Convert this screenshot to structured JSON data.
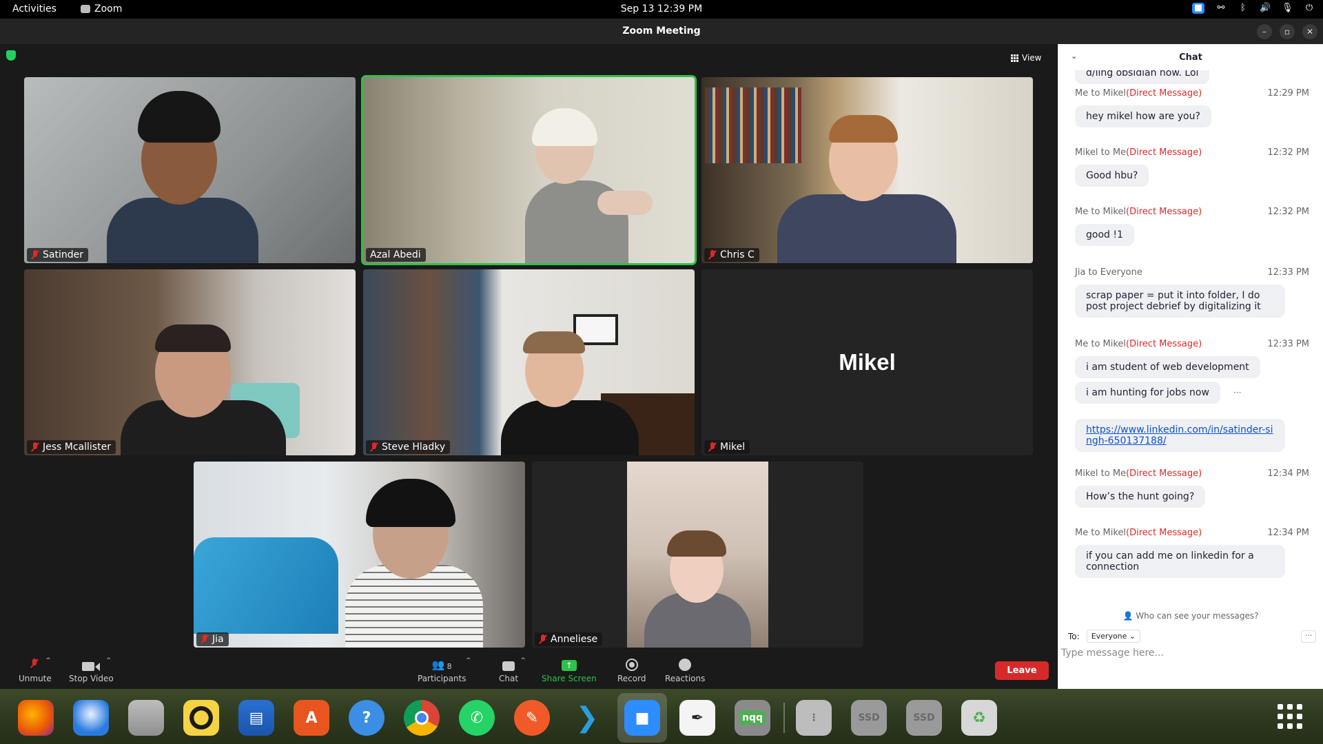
{
  "topbar": {
    "activities": "Activities",
    "app_name": "Zoom",
    "clock": "Sep 13  12:39 PM"
  },
  "window": {
    "title": "Zoom Meeting"
  },
  "meeting": {
    "view_label": "View",
    "participants": [
      {
        "name": "Satinder",
        "muted": true
      },
      {
        "name": "Azal Abedi",
        "muted": false,
        "active_speaker": true
      },
      {
        "name": "Chris C",
        "muted": true
      },
      {
        "name": "Jess Mcallister",
        "muted": true
      },
      {
        "name": "Steve Hladky",
        "muted": true
      },
      {
        "name": "Mikel",
        "muted": true,
        "video_off": true,
        "display_text": "Mikel"
      },
      {
        "name": "Jia",
        "muted": true
      },
      {
        "name": "Anneliese",
        "muted": true
      }
    ]
  },
  "chat": {
    "title": "Chat",
    "messages": [
      {
        "sender": "",
        "dm": "",
        "time": "",
        "text": "d/ling obsidian now. Lol"
      },
      {
        "sender": "Me to Mikel",
        "dm": "(Direct Message)",
        "time": "12:29 PM",
        "text": "hey mikel how are you?"
      },
      {
        "sender": "Mikel to Me",
        "dm": "(Direct Message)",
        "time": "12:32 PM",
        "text": "Good hbu?"
      },
      {
        "sender": "Me to Mikel",
        "dm": "(Direct Message)",
        "time": "12:32 PM",
        "text": "good !1"
      },
      {
        "sender": "Jia to Everyone",
        "dm": "",
        "time": "12:33 PM",
        "text": "scrap paper = put it into folder, I do post project debrief by digitalizing it"
      },
      {
        "sender": "Me to Mikel",
        "dm": "(Direct Message)",
        "time": "12:33 PM",
        "text": "i am student of web development"
      },
      {
        "sender": "",
        "dm": "",
        "time": "",
        "text": "i am hunting for jobs now"
      },
      {
        "sender": "",
        "dm": "",
        "time": "",
        "text": "https://www.linkedin.com/in/satinder-singh-650137188/"
      },
      {
        "sender": "Mikel to Me",
        "dm": "(Direct Message)",
        "time": "12:34 PM",
        "text": "How’s the hunt going?"
      },
      {
        "sender": "Me to Mikel",
        "dm": "(Direct Message)",
        "time": "12:34 PM",
        "text": "if you can add me on linkedin for a connection"
      }
    ],
    "more_glyph": "···",
    "who_can_see": "Who can see your messages?",
    "to_label": "To:",
    "to_value": "Everyone",
    "to_more": "···",
    "input_placeholder": "Type message here..."
  },
  "toolbar": {
    "unmute": "Unmute",
    "stop_video": "Stop Video",
    "participants": "Participants",
    "participants_count": "8",
    "chat": "Chat",
    "share_screen": "Share Screen",
    "record": "Record",
    "reactions": "Reactions",
    "leave": "Leave"
  },
  "dock": {
    "apps": [
      "firefox-icon",
      "thunderbird-icon",
      "files-icon",
      "rhythmbox-icon",
      "writer-icon",
      "software-center-icon",
      "help-icon",
      "chrome-icon",
      "whatsapp-icon",
      "pen-app-icon",
      "vscode-icon",
      "zoom-icon",
      "inkscape-icon",
      "nqq-icon",
      "drive-icon",
      "ssd-icon",
      "ssd-icon-2",
      "trash-icon"
    ],
    "nqq_label": "nqq",
    "ssd_label": "SSD",
    "colors": {
      "zoom": "#2D8CFF",
      "share": "#2DC24A",
      "leave": "#D62A2A",
      "dm": "#E02828"
    }
  }
}
